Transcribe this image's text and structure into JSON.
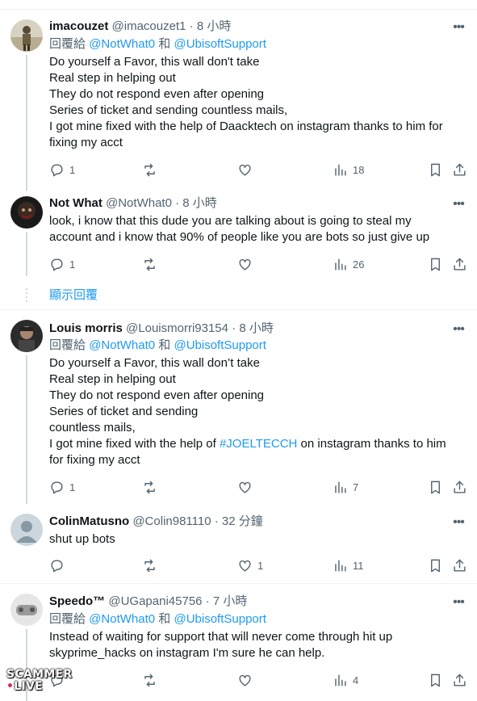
{
  "tweets": [
    {
      "name": "imacouzet",
      "handle": "@imacouzet1",
      "time": "8 小時",
      "reply_prefix": "回覆給",
      "reply_mention1": "@NotWhat0",
      "reply_and": "和",
      "reply_mention2": "@UbisoftSupport",
      "body_lines": [
        "Do yourself a Favor, this wall don't take",
        "Real step in helping out",
        "They do not respond even after opening",
        "Series of ticket and sending countless mails,",
        "I got mine fixed with the help of Daacktech on instagram thanks to him for",
        "fixing my acct"
      ],
      "reply_count": "1",
      "retweet_count": "",
      "like_count": "",
      "view_count": "18"
    },
    {
      "name": "Not What",
      "handle": "@NotWhat0",
      "time": "8 小時",
      "body_lines": [
        "look, i know that this dude you are talking about is going to steal my",
        "account and i know that 90% of people like you are bots so just give up"
      ],
      "reply_count": "1",
      "retweet_count": "",
      "like_count": "",
      "view_count": "26"
    },
    {
      "name": "Louis morris",
      "handle": "@Louismorri93154",
      "time": "8 小時",
      "reply_prefix": "回覆給",
      "reply_mention1": "@NotWhat0",
      "reply_and": "和",
      "reply_mention2": "@UbisoftSupport",
      "body_lines": [
        "Do yourself a Favor, this wall don’t take",
        "Real step in helping out",
        "They do not respond even after opening",
        "Series of ticket and sending",
        "countless mails,"
      ],
      "body_line6_pre": "I got mine fixed with the help of ",
      "body_line6_hashtag": "#JOELTECCH",
      "body_line6_post": "  on instagram thanks to him",
      "body_line7": "for fixing my acct",
      "reply_count": "1",
      "retweet_count": "",
      "like_count": "",
      "view_count": "7"
    },
    {
      "name": "ColinMatusno",
      "handle": "@Colin981110",
      "time": "32 分鐘",
      "body_lines": [
        "shut up bots"
      ],
      "reply_count": "",
      "retweet_count": "",
      "like_count": "1",
      "view_count": "11"
    },
    {
      "name": "Speedo™",
      "handle": "@UGapani45756",
      "time": "7 小時",
      "reply_prefix": "回覆給",
      "reply_mention1": "@NotWhat0",
      "reply_and": "和",
      "reply_mention2": "@UbisoftSupport",
      "body_lines": [
        "Instead of waiting for support that will never come through hit up",
        "skyprime_hacks on instagram I'm sure he can help."
      ],
      "reply_count": "",
      "retweet_count": "",
      "like_count": "",
      "view_count": "4"
    }
  ],
  "show_replies_label": "顯示回覆",
  "separator_dot": "·",
  "watermark": {
    "line1": "SCAMMER",
    "line2": "LIVE",
    "dot": "•"
  },
  "colors": {
    "accent": "#1d9bf0",
    "text": "#0f1419",
    "muted": "#536471",
    "border": "#eff3f4"
  }
}
